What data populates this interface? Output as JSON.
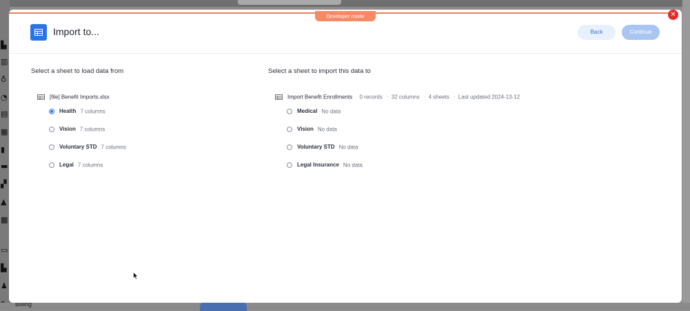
{
  "developer_mode_label": "Developer mode",
  "background": {
    "billing_label": "Billing"
  },
  "modal": {
    "title": "Import to...",
    "back_label": "Back",
    "continue_label": "Continue"
  },
  "left": {
    "heading": "Select a sheet to load data from",
    "file_name": "[file] Benefit Imports.xlsx",
    "sheets": [
      {
        "name": "Health",
        "desc": "7 columns",
        "selected": true
      },
      {
        "name": "Vision",
        "desc": "7 columns",
        "selected": false
      },
      {
        "name": "Voluntary STD",
        "desc": "7 columns",
        "selected": false
      },
      {
        "name": "Legal",
        "desc": "7 columns",
        "selected": false
      }
    ]
  },
  "right": {
    "heading": "Select a sheet to import this data to",
    "target_name": "Import Benefit Enrollments",
    "records": "0 records",
    "columns": "32 columns",
    "sheets_count": "4 sheets",
    "last_updated": "Last updated 2024-13-12",
    "sheets": [
      {
        "name": "Medical",
        "desc": "No data"
      },
      {
        "name": "Vision",
        "desc": "No data"
      },
      {
        "name": "Voluntary STD",
        "desc": "No data"
      },
      {
        "name": "Legal Insurance",
        "desc": "No data"
      }
    ]
  },
  "colors": {
    "accent": "#2d73e8",
    "developer_mode": "#f58a66",
    "close": "#e62b2b"
  }
}
